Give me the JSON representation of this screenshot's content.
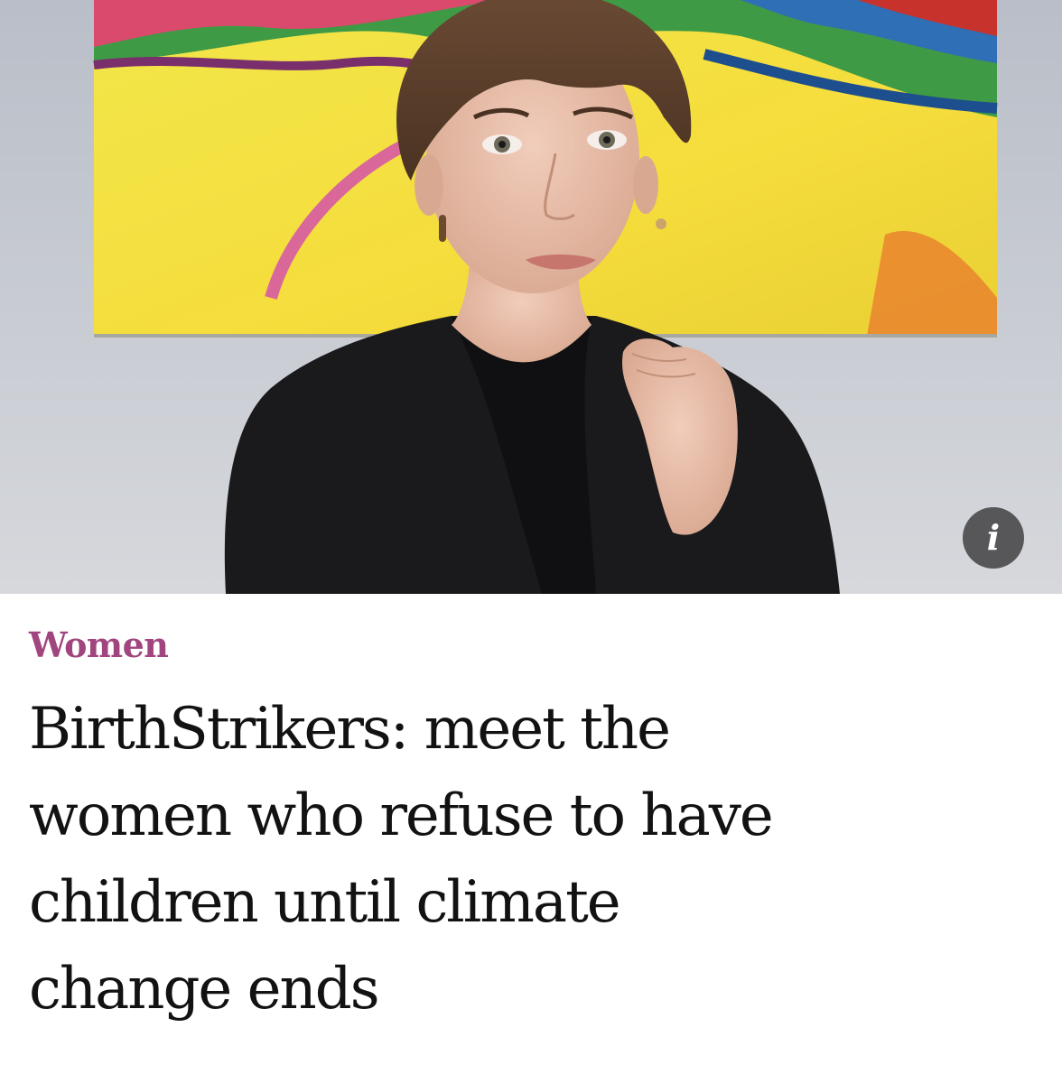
{
  "hero": {
    "alt": "Photo of a woman with short brown hair in a black cardigan, hand on shoulder, in front of a colourful painting",
    "info_icon": "info-icon",
    "info_label": "i"
  },
  "article": {
    "section": "Women",
    "headline_lines": [
      "BirthStrikers: meet the",
      "women who refuse to have",
      "children until climate",
      "change ends"
    ]
  },
  "colors": {
    "section": "#a1457e",
    "headline": "#121212",
    "info_button_bg": "#464648"
  }
}
